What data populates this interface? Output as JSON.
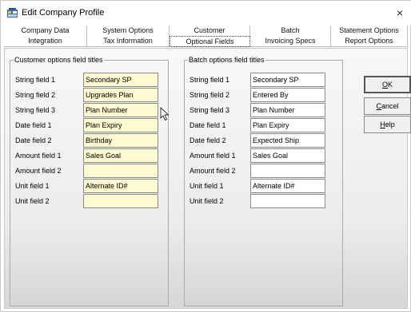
{
  "window": {
    "title": "Edit Company Profile",
    "close_glyph": "×"
  },
  "tabs": {
    "row1": [
      "Company Data",
      "System Options",
      "Customer",
      "Batch",
      "Statement Options"
    ],
    "row2": [
      "Integration",
      "Tax Information",
      "Optional Fields",
      "Invoicing Specs",
      "Report Options"
    ],
    "active": "Optional Fields"
  },
  "customer_group": {
    "title": "Customer options field titles",
    "fields": [
      {
        "label": "String field 1",
        "value": "Secondary SP"
      },
      {
        "label": "String field 2",
        "value": "Upgrades Plan"
      },
      {
        "label": "String field 3",
        "value": "Plan Number"
      },
      {
        "label": "Date field 1",
        "value": "Plan Expiry"
      },
      {
        "label": "Date field 2",
        "value": "Birthday"
      },
      {
        "label": "Amount field 1",
        "value": "Sales Goal"
      },
      {
        "label": "Amount field 2",
        "value": ""
      },
      {
        "label": "Unit field 1",
        "value": "Alternate ID#"
      },
      {
        "label": "Unit field 2",
        "value": ""
      }
    ]
  },
  "batch_group": {
    "title": "Batch options field titles",
    "fields": [
      {
        "label": "String field 1",
        "value": "Secondary SP"
      },
      {
        "label": "String field 2",
        "value": "Entered By"
      },
      {
        "label": "String field 3",
        "value": "Plan Number"
      },
      {
        "label": "Date field 1",
        "value": "Plan Expiry"
      },
      {
        "label": "Date field 2",
        "value": "Expected Ship"
      },
      {
        "label": "Amount field 1",
        "value": "Sales Goal"
      },
      {
        "label": "Amount field 2",
        "value": ""
      },
      {
        "label": "Unit field 1",
        "value": "Alternate ID#"
      },
      {
        "label": "Unit field 2",
        "value": ""
      }
    ]
  },
  "buttons": {
    "ok": {
      "label": "OK",
      "mnemonic": "O",
      "rest": "K"
    },
    "cancel": {
      "label": "Cancel",
      "mnemonic": "C",
      "rest": "ancel"
    },
    "help": {
      "label": "Help",
      "mnemonic": "H",
      "rest": "elp"
    }
  },
  "colors": {
    "highlight_field": "#fdf9d0"
  }
}
